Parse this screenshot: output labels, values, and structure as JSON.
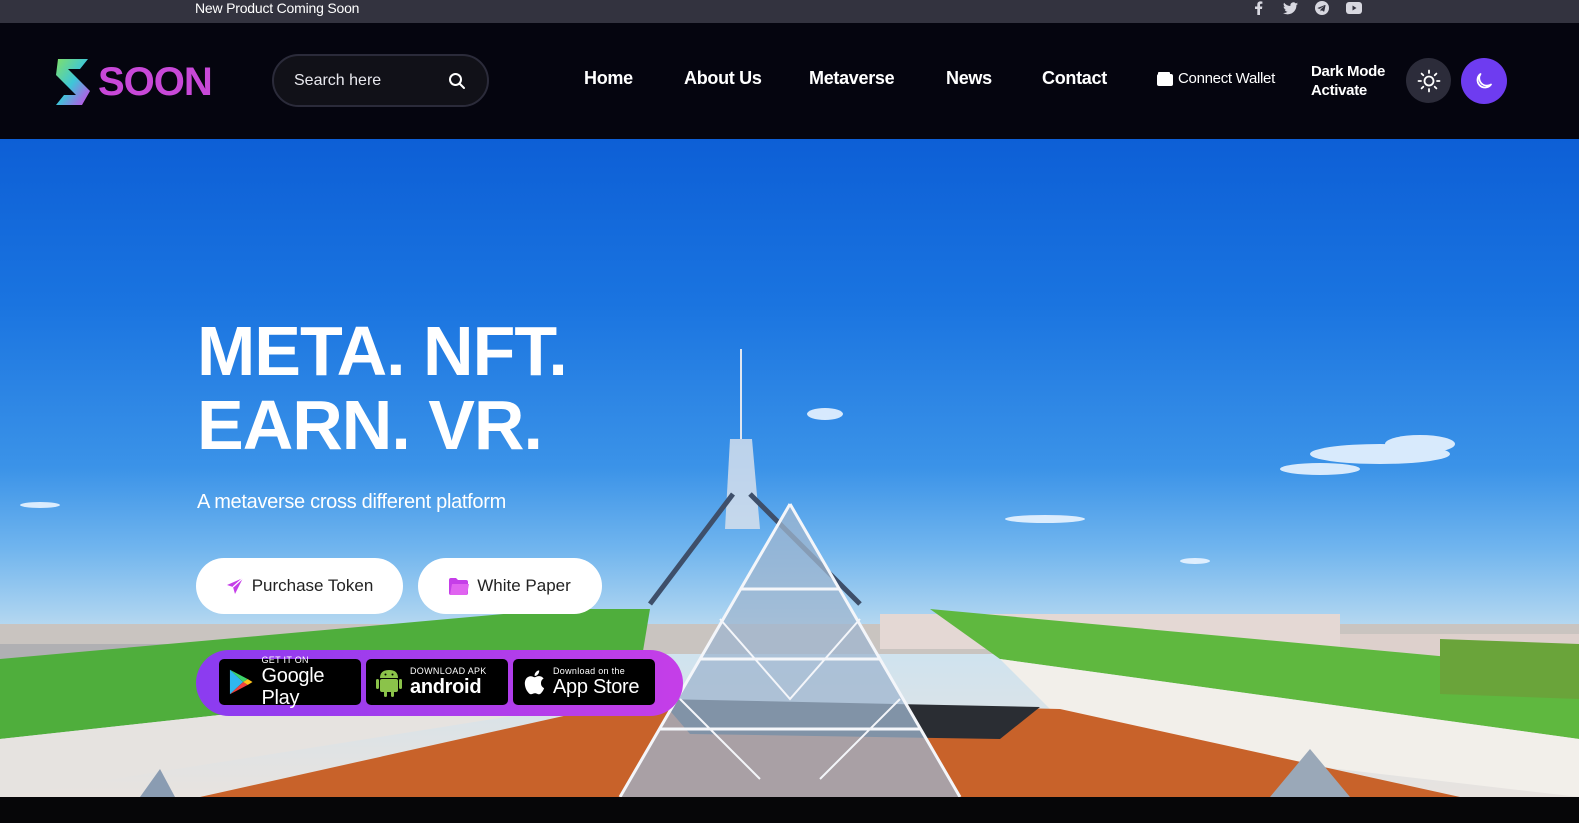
{
  "topbar": {
    "announcement": "New Product Coming Soon",
    "social_icons": [
      "facebook-icon",
      "twitter-icon",
      "telegram-icon",
      "youtube-icon"
    ]
  },
  "header": {
    "logo_text": "SOON",
    "search": {
      "placeholder": "Search here",
      "value": ""
    },
    "nav": [
      "Home",
      "About Us",
      "Metaverse",
      "News",
      "Contact"
    ],
    "wallet_label": "Connect Wallet",
    "dark_mode_line1": "Dark Mode",
    "dark_mode_line2": "Activate"
  },
  "hero": {
    "headline_line1": "META. NFT.",
    "headline_line2": "EARN. VR.",
    "subtitle": "A metaverse cross different platform",
    "purchase_label": "Purchase Token",
    "whitepaper_label": "White Paper",
    "stores": {
      "google_small": "GET IT ON",
      "google_big": "Google Play",
      "android_small": "DOWNLOAD APK",
      "android_big": "android",
      "apple_small": "Download on the",
      "apple_big": "App Store"
    }
  },
  "colors": {
    "accent_purple": "#6e3cf0",
    "brand_magenta": "#c848d8",
    "nav_bg": "#05050f",
    "topbar_bg": "#33333f"
  }
}
